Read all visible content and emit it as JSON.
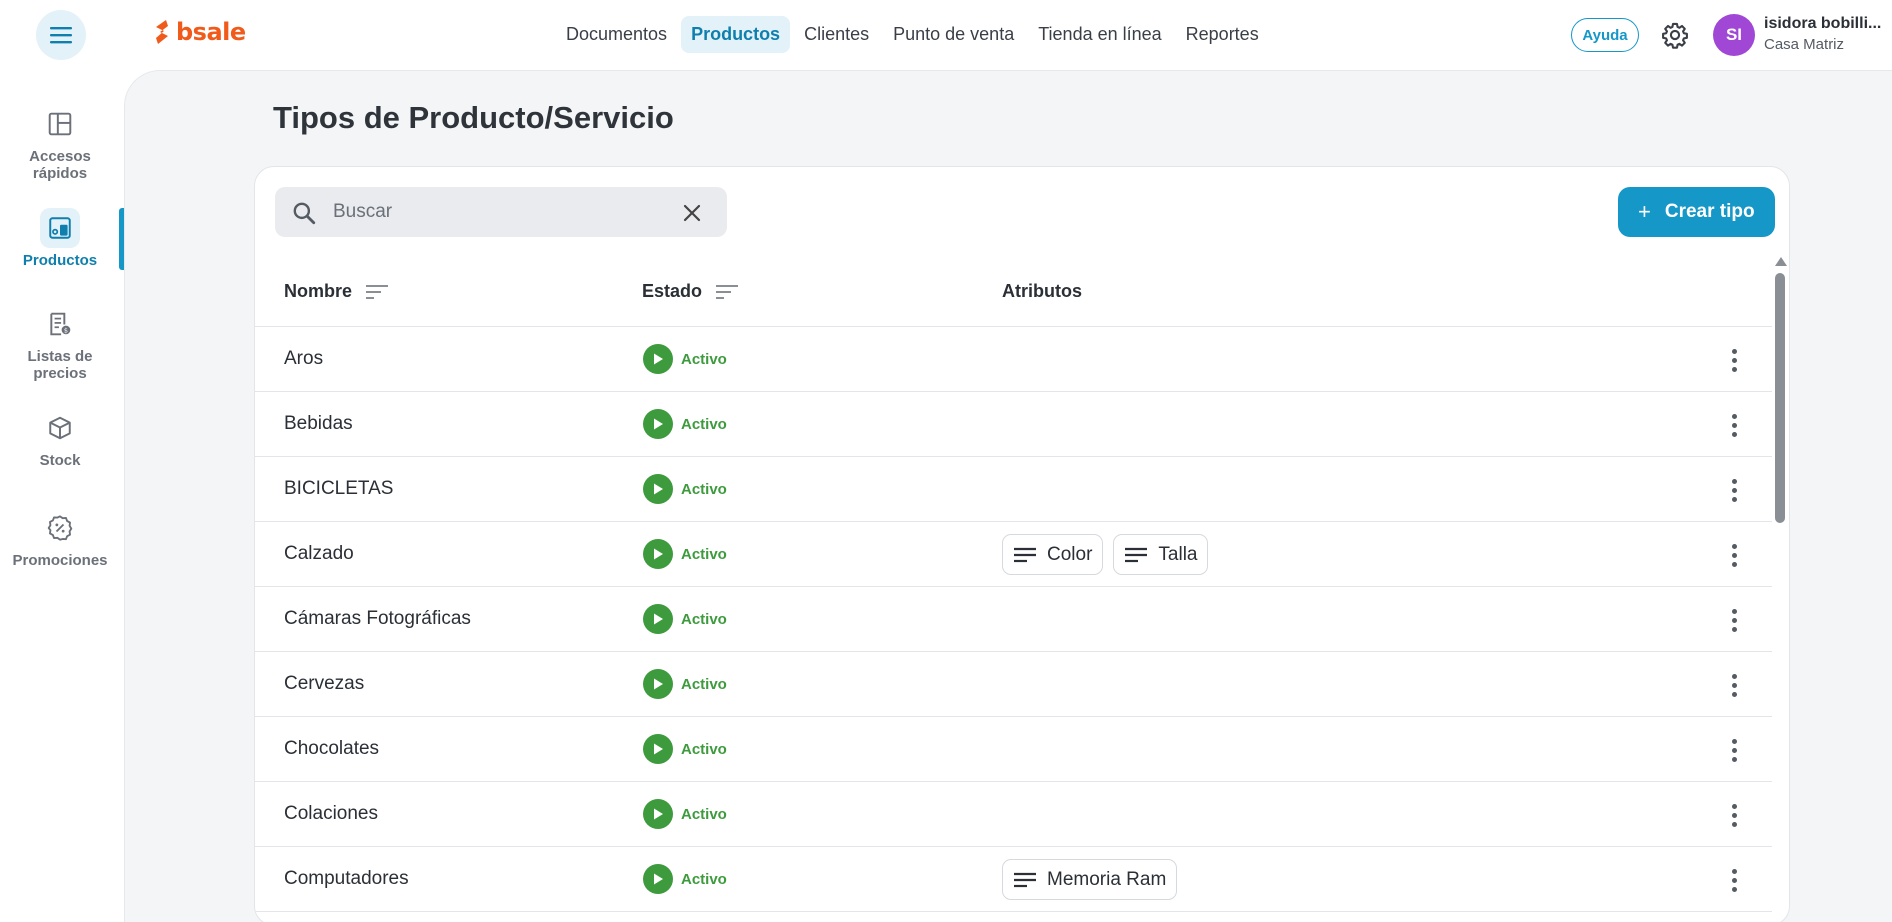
{
  "brand": {
    "logo_text": "bsale",
    "accent": "#1597c8",
    "logo_color": "#f05a1a"
  },
  "topnav": {
    "items": [
      {
        "label": "Documentos",
        "active": false
      },
      {
        "label": "Productos",
        "active": true
      },
      {
        "label": "Clientes",
        "active": false
      },
      {
        "label": "Punto de venta",
        "active": false
      },
      {
        "label": "Tienda en línea",
        "active": false
      },
      {
        "label": "Reportes",
        "active": false
      }
    ],
    "help_label": "Ayuda",
    "settings_icon": "gear-icon"
  },
  "user": {
    "initials": "SI",
    "name": "isidora bobilli...",
    "branch": "Casa Matriz",
    "avatar_color": "#a047d6"
  },
  "sidebar": {
    "items": [
      {
        "label": "Accesos rápidos",
        "icon": "layout-icon",
        "active": false
      },
      {
        "label": "Productos",
        "icon": "products-icon",
        "active": true
      },
      {
        "label": "Listas de precios",
        "icon": "price-list-icon",
        "active": false
      },
      {
        "label": "Stock",
        "icon": "box-icon",
        "active": false
      },
      {
        "label": "Promociones",
        "icon": "discount-icon",
        "active": false
      }
    ]
  },
  "page": {
    "title": "Tipos de Producto/Servicio"
  },
  "search": {
    "placeholder": "Buscar",
    "value": ""
  },
  "actions": {
    "create_label": "Crear tipo"
  },
  "table": {
    "columns": {
      "name": "Nombre",
      "status": "Estado",
      "attributes": "Atributos"
    },
    "rows": [
      {
        "name": "Aros",
        "status": "Activo",
        "attributes": []
      },
      {
        "name": "Bebidas",
        "status": "Activo",
        "attributes": []
      },
      {
        "name": "BICICLETAS",
        "status": "Activo",
        "attributes": []
      },
      {
        "name": "Calzado",
        "status": "Activo",
        "attributes": [
          "Color",
          "Talla"
        ]
      },
      {
        "name": "Cámaras Fotográficas",
        "status": "Activo",
        "attributes": []
      },
      {
        "name": "Cervezas",
        "status": "Activo",
        "attributes": []
      },
      {
        "name": "Chocolates",
        "status": "Activo",
        "attributes": []
      },
      {
        "name": "Colaciones",
        "status": "Activo",
        "attributes": []
      },
      {
        "name": "Computadores",
        "status": "Activo",
        "attributes": [
          "Memoria Ram"
        ]
      }
    ]
  }
}
